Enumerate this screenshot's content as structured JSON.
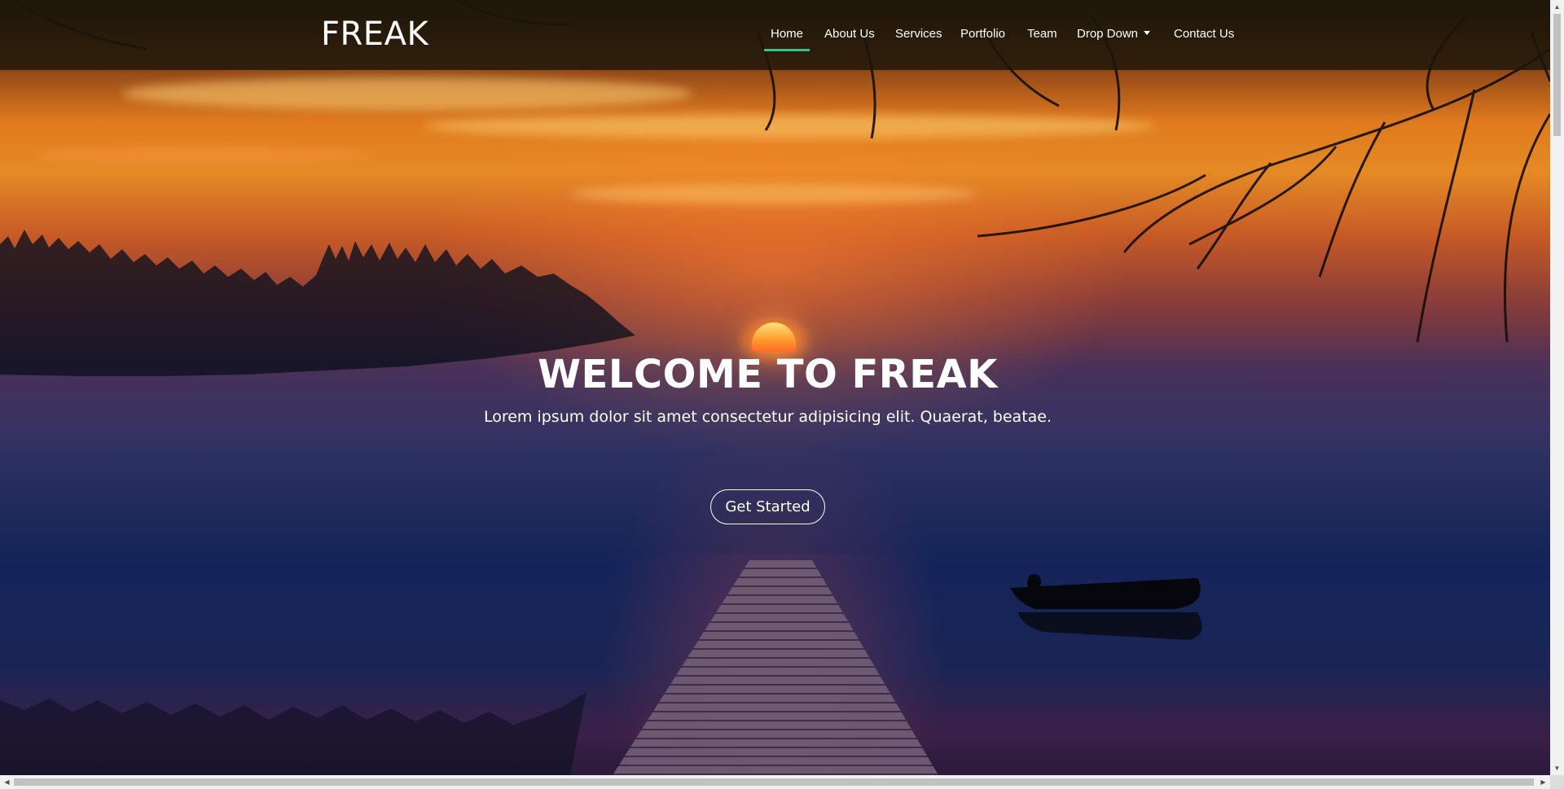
{
  "brand": {
    "name": "FREAK"
  },
  "nav": {
    "items": [
      {
        "label": "Home",
        "active": true
      },
      {
        "label": "About Us"
      },
      {
        "label": "Services"
      },
      {
        "label": "Portfolio"
      },
      {
        "label": "Team"
      },
      {
        "label": "Drop Down",
        "has_dropdown": true
      },
      {
        "label": "Contact Us"
      }
    ]
  },
  "hero": {
    "title": "WELCOME TO FREAK",
    "subtitle": "Lorem ipsum dolor sit amet consectetur adipisicing elit. Quaerat, beatae.",
    "cta_label": "Get Started",
    "background": "sunset-lake-with-dock-image"
  },
  "colors": {
    "accent": "#2ec48c",
    "navbar_bg": "#1c1608",
    "text": "#ffffff"
  },
  "icons": {
    "dropdown": "caret-down-icon",
    "scroll_up": "arrow-up-icon",
    "scroll_down": "arrow-down-icon",
    "scroll_left": "arrow-left-icon",
    "scroll_right": "arrow-right-icon"
  }
}
